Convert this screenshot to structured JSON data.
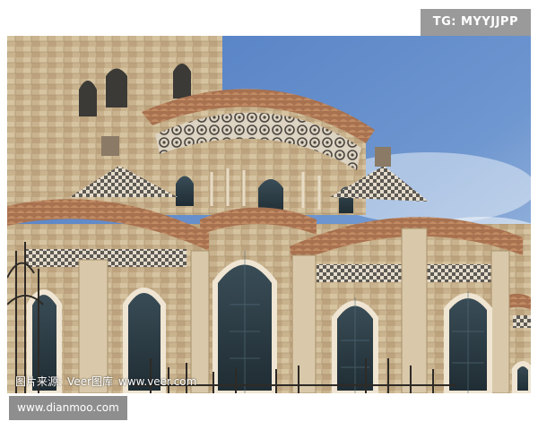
{
  "tag_badge": "TG: MYYJJPP",
  "photo": {
    "subject": "romanesque-church-apse",
    "credit_label": "图片来源:",
    "credit_source": "Veer图库",
    "credit_url": "www.veer.com"
  },
  "source_badge": "www.dianmoo.com",
  "colors": {
    "sky": "#5f88c9",
    "stone": "#c8b08a",
    "roof": "#b07a56",
    "window": "#2a3b44"
  }
}
